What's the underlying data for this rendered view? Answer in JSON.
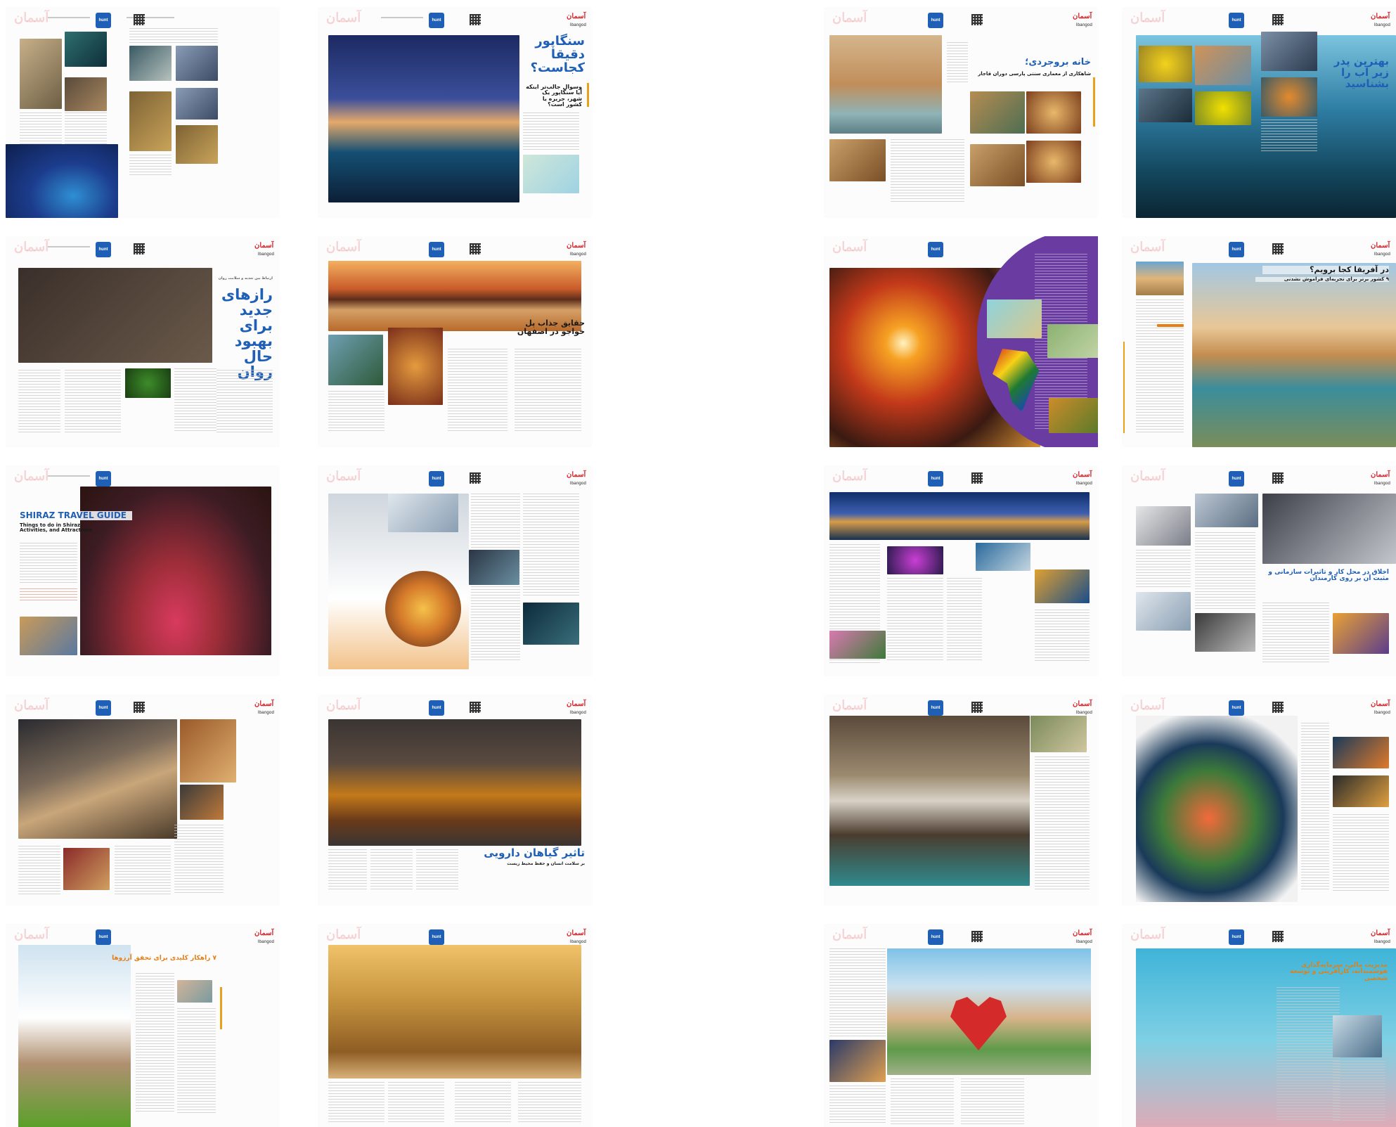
{
  "brand": {
    "logo_text": "آسمان",
    "wordmark": "Ibangod",
    "hunt_label": "hunt"
  },
  "pages": {
    "singapore": {
      "title": "سنگاپور دقیقا کجاست؟",
      "subtitle": "وسوال جالب‌تر اینکه آیا سنگاپور یک شهر، جزیره یا کشور است؟"
    },
    "borujerdi": {
      "title": "خانه بروجردی؛",
      "subtitle": "شاهکاری از معماری سنتی پارسی دوران قاجار"
    },
    "fish": {
      "title": "بهترین پدر زیر آب را بشناسید"
    },
    "psych": {
      "kicker": "ارتباط بین تغذیه و سلامت روان",
      "title": "رازهای جدید برای بهبود حال روان"
    },
    "khaju": {
      "title": "حقایق جذاب پل خواجو در اصفهان"
    },
    "africa": {
      "title": "در آفریقا کجا برویم؟",
      "subtitle": "۹ کشور برتر برای تجربه‌ای فراموش نشدنی"
    },
    "shiraz": {
      "title": "SHIRAZ TRAVEL GUIDE",
      "subtitle": "Things to do in Shiraz, Activities, and Attractions"
    },
    "ethics": {
      "title": "اخلاق در محل کار و تاثیرات سازمانی و مثبت آن بر روی کارمندان"
    },
    "herbs": {
      "title": "تاثیر گیاهان دارویی",
      "subtitle": "بر سلامت انسان و حفظ محیط زیست"
    },
    "goals": {
      "title": "۷ راهکار کلیدی برای تحقق آرزوها"
    },
    "finance": {
      "title": "مدیریت مالی، سرمایه‌گذاری هوشمندانه، کارآفرینی و توسعه شخصی"
    }
  }
}
